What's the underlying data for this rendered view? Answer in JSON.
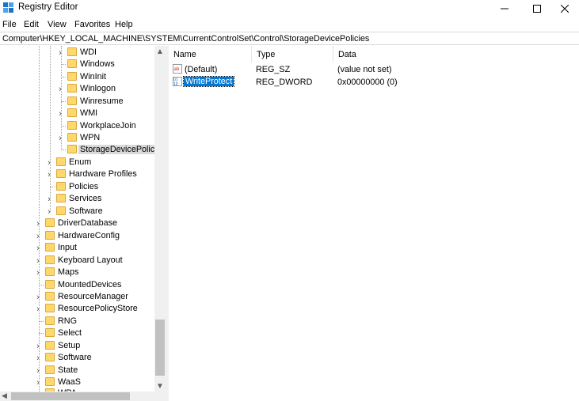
{
  "window": {
    "title": "Registry Editor"
  },
  "menu": {
    "items": [
      "File",
      "Edit",
      "View",
      "Favorites",
      "Help"
    ]
  },
  "address": {
    "path": "Computer\\HKEY_LOCAL_MACHINE\\SYSTEM\\CurrentControlSet\\Control\\StorageDevicePolicies"
  },
  "tree": {
    "items": [
      {
        "label": "WDI",
        "has_children": true,
        "selected": false
      },
      {
        "label": "Windows",
        "has_children": false,
        "selected": false
      },
      {
        "label": "WinInit",
        "has_children": false,
        "selected": false
      },
      {
        "label": "Winlogon",
        "has_children": true,
        "selected": false
      },
      {
        "label": "Winresume",
        "has_children": false,
        "selected": false
      },
      {
        "label": "WMI",
        "has_children": true,
        "selected": false
      },
      {
        "label": "WorkplaceJoin",
        "has_children": false,
        "selected": false
      },
      {
        "label": "WPN",
        "has_children": true,
        "selected": false
      },
      {
        "label": "StorageDevicePolicies",
        "has_children": false,
        "selected": true
      },
      {
        "label": "Enum",
        "has_children": true,
        "selected": false
      },
      {
        "label": "Hardware Profiles",
        "has_children": true,
        "selected": false
      },
      {
        "label": "Policies",
        "has_children": false,
        "selected": false
      },
      {
        "label": "Services",
        "has_children": true,
        "selected": false
      },
      {
        "label": "Software",
        "has_children": true,
        "selected": false
      },
      {
        "label": "DriverDatabase",
        "has_children": true,
        "selected": false
      },
      {
        "label": "HardwareConfig",
        "has_children": true,
        "selected": false
      },
      {
        "label": "Input",
        "has_children": true,
        "selected": false
      },
      {
        "label": "Keyboard Layout",
        "has_children": true,
        "selected": false
      },
      {
        "label": "Maps",
        "has_children": true,
        "selected": false
      },
      {
        "label": "MountedDevices",
        "has_children": false,
        "selected": false
      },
      {
        "label": "ResourceManager",
        "has_children": true,
        "selected": false
      },
      {
        "label": "ResourcePolicyStore",
        "has_children": true,
        "selected": false
      },
      {
        "label": "RNG",
        "has_children": false,
        "selected": false
      },
      {
        "label": "Select",
        "has_children": false,
        "selected": false
      },
      {
        "label": "Setup",
        "has_children": true,
        "selected": false
      },
      {
        "label": "Software",
        "has_children": true,
        "selected": false
      },
      {
        "label": "State",
        "has_children": true,
        "selected": false
      },
      {
        "label": "WaaS",
        "has_children": true,
        "selected": false
      },
      {
        "label": "WPA",
        "has_children": true,
        "selected": false
      }
    ]
  },
  "list": {
    "columns": [
      "Name",
      "Type",
      "Data"
    ],
    "rows": [
      {
        "name": "(Default)",
        "type": "REG_SZ",
        "data": "(value not set)",
        "icon": "string-value-icon",
        "selected": false
      },
      {
        "name": "WriteProtect",
        "type": "REG_DWORD",
        "data": "0x00000000 (0)",
        "icon": "binary-value-icon",
        "selected": true
      }
    ]
  },
  "colors": {
    "selection": "#0078d7",
    "folder": "#ffd86b"
  }
}
